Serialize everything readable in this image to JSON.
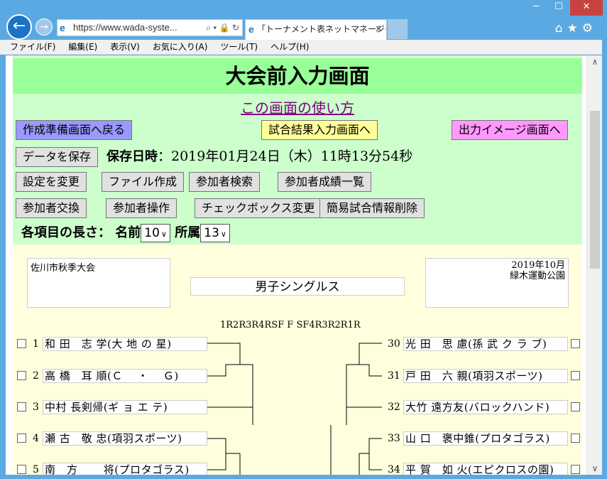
{
  "browser": {
    "address": "https://www.wada-syste...",
    "tab_title": "｢トーナメント表ネットマネージャ...",
    "window_controls": [
      "─",
      "☐",
      "✕"
    ],
    "toolbar_icons": [
      "home-icon",
      "star-icon",
      "gear-icon"
    ]
  },
  "menu": [
    "ファイル(F)",
    "編集(E)",
    "表示(V)",
    "お気に入り(A)",
    "ツール(T)",
    "ヘルプ(H)"
  ],
  "page": {
    "title": "大会前入力画面",
    "howto_link": "この画面の使い方",
    "buttons": {
      "back": "作成準備画面へ戻る",
      "result": "試合結果入力画面へ",
      "output": "出力イメージ画面へ",
      "save": "データを保存"
    },
    "save_label": "保存日時",
    "save_value": "：2019年01月24日（木）11時13分54秒",
    "row1": [
      "設定を変更",
      "ファイル作成",
      "参加者検索",
      "参加者成績一覧"
    ],
    "row2": [
      "参加者交換",
      "参加者操作",
      "チェックボックス変更",
      "簡易試合情報削除"
    ],
    "length": {
      "label": "各項目の長さ：",
      "name_label": "名前",
      "name_value": "10",
      "org_label": "所属",
      "org_value": "13"
    }
  },
  "tournament": {
    "left_box": "佐川市秋季大会",
    "event": "男子シングルス",
    "right_box_line1": "2019年10月",
    "right_box_line2": "緑木運動公園",
    "rounds": "1R2R3R4RSF  F  SF4R3R2R1R",
    "left_entries": [
      {
        "num": "1",
        "name": "和 田　志 学(大 地 の 星)"
      },
      {
        "num": "2",
        "name": "高 橋　耳 順(Ｃ　 ・　 Ｇ)"
      },
      {
        "num": "3",
        "name": "中村 長剣帰(ギ ョ エ テ)"
      },
      {
        "num": "4",
        "name": "瀬 古　敬 忠(項羽スポーツ)"
      },
      {
        "num": "5",
        "name": "南　方　　 将(プロタゴラス)"
      }
    ],
    "right_entries": [
      {
        "num": "30",
        "name": "光 田　思 慮(孫 武 ク ラ ブ)"
      },
      {
        "num": "31",
        "name": "戸 田　六 親(項羽スポーツ)"
      },
      {
        "num": "32",
        "name": "大竹 遠方友(バロックハンド)"
      },
      {
        "num": "33",
        "name": "山 口　褒中錐(プロタゴラス)"
      },
      {
        "num": "34",
        "name": "平 賀　如 火(エピクロスの園)"
      }
    ]
  }
}
